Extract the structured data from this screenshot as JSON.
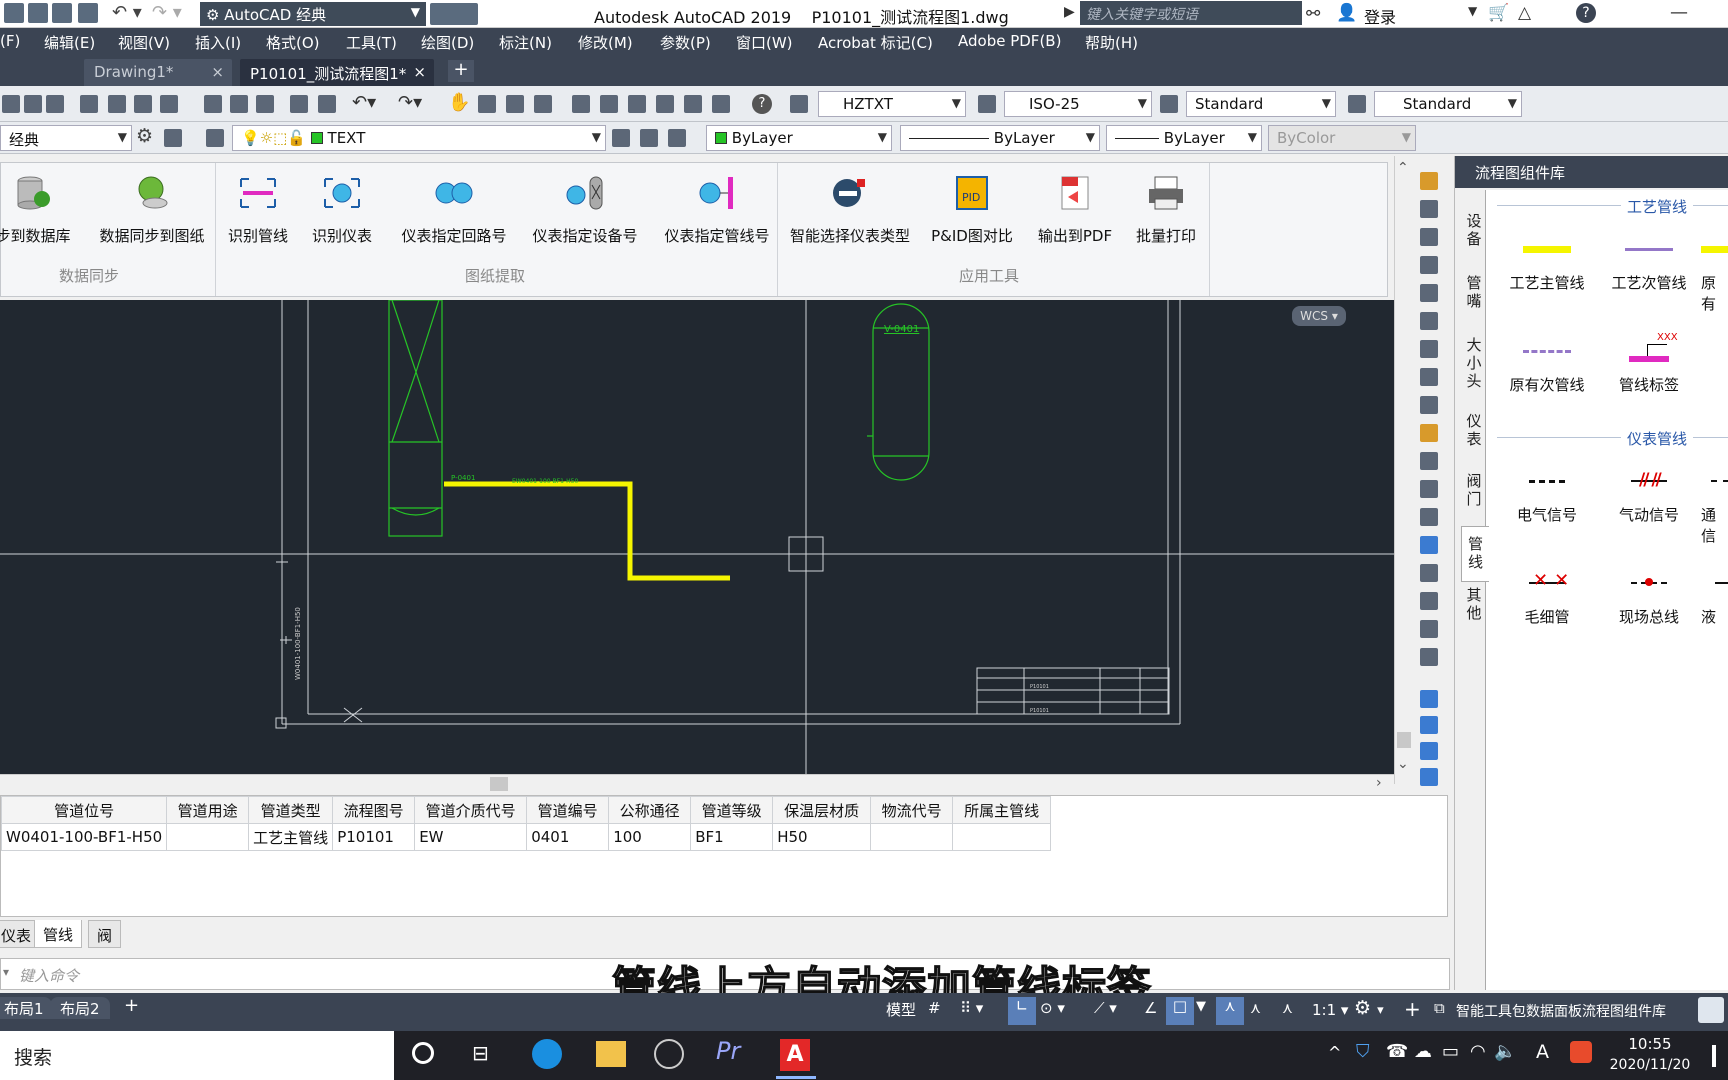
{
  "title_bar": {
    "workspace": "AutoCAD 经典",
    "app_title": "Autodesk AutoCAD 2019    P10101_测试流程图1.dwg",
    "search_placeholder": "键入关键字或短语",
    "login": "登录"
  },
  "menu": [
    "(F)",
    "编辑(E)",
    "视图(V)",
    "插入(I)",
    "格式(O)",
    "工具(T)",
    "绘图(D)",
    "标注(N)",
    "修改(M)",
    "参数(P)",
    "窗口(W)",
    "Acrobat 标记(C)",
    "Adobe PDF(B)",
    "帮助(H)"
  ],
  "file_tabs": [
    "Drawing1*",
    "P10101_测试流程图1*"
  ],
  "toolbar": {
    "text_style": "HZTXT",
    "dim_style": "ISO-25",
    "table_style": "Standard",
    "multileader_style": "Standard",
    "workspace2": "经典",
    "layer": "TEXT",
    "color": "ByLayer",
    "linetype": "ByLayer",
    "lineweight": "ByLayer",
    "plotstyle": "ByColor"
  },
  "ribbon": {
    "buttons": [
      "步到数据库",
      "数据同步到图纸",
      "识别管线",
      "识别仪表",
      "仪表指定回路号",
      "仪表指定设备号",
      "仪表指定管线号",
      "智能选择仪表类型",
      "P&ID图对比",
      "输出到PDF",
      "批量打印"
    ],
    "groups": [
      "数据同步",
      "图纸提取",
      "应用工具"
    ]
  },
  "drawing": {
    "vessel_tag": "V-0401",
    "pump_tag": "P-0401",
    "wcs": "WCS"
  },
  "palette": {
    "title": "流程图组件库",
    "side_tabs": [
      "设备",
      "管嘴",
      "大小头",
      "仪表",
      "阀门",
      "管线",
      "其他"
    ],
    "section1": "工艺管线",
    "section2": "仪表管线",
    "items1": [
      "工艺主管线",
      "工艺次管线",
      "原有",
      "原有次管线",
      "管线标签"
    ],
    "tag_text": "XXX",
    "items2": [
      "电气信号",
      "气动信号",
      "通信",
      "毛细管",
      "现场总线",
      "液"
    ]
  },
  "table": {
    "headers": [
      "管道位号",
      "管道用途",
      "管道类型",
      "流程图号",
      "管道介质代号",
      "管道编号",
      "公称通径",
      "管道等级",
      "保温层材质",
      "物流代号",
      "所属主管线"
    ],
    "rows": [
      [
        "W0401-100-BF1-H50",
        "",
        "工艺主管线",
        "P10101",
        "EW",
        "0401",
        "100",
        "BF1",
        "H50",
        "",
        ""
      ]
    ],
    "tabs": [
      "仪表",
      "管线",
      "阀"
    ]
  },
  "command_prompt": "键入命令",
  "layout_tabs": [
    "布局1",
    "布局2"
  ],
  "status": {
    "model": "模型",
    "scale": "1:1",
    "right_text": "智能工具包数据面板流程图组件库"
  },
  "subtitle": "管线上方自动添加管线标签",
  "taskbar": {
    "search": "搜索",
    "time": "10:55",
    "date": "2020/11/20",
    "ime": "A"
  },
  "colors": {
    "pipe_yellow": "#f5f500",
    "cad_green": "#26c426",
    "canvas": "#212830"
  }
}
